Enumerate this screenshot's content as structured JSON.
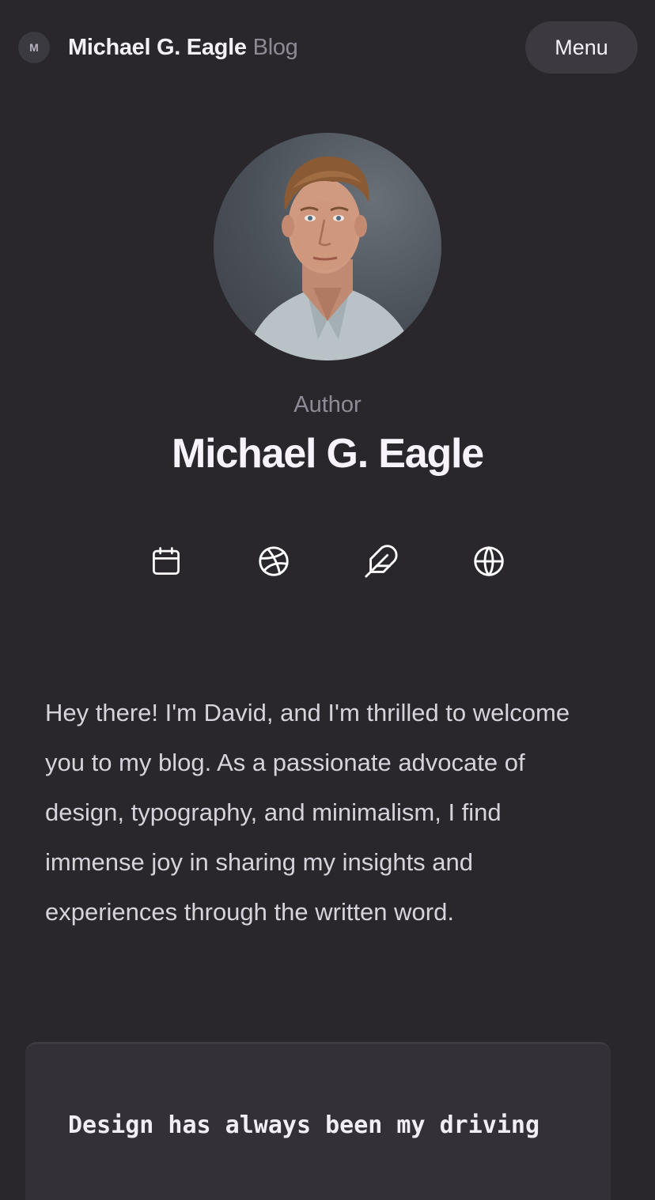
{
  "header": {
    "logo_initial": "M",
    "site_name": "Michael G. Eagle",
    "site_suffix": "Blog",
    "menu_label": "Menu"
  },
  "profile": {
    "label": "Author",
    "name": "Michael G. Eagle",
    "photo_alt": "Michael G. Eagle"
  },
  "social_icons": [
    {
      "icon": "calendar-icon"
    },
    {
      "icon": "dribbble-icon"
    },
    {
      "icon": "feather-icon"
    },
    {
      "icon": "globe-icon"
    }
  ],
  "bio": {
    "text": "Hey there! I'm David, and I'm thrilled to welcome you to my blog. As a passionate advocate of design, typography, and minimalism, I find immense joy in sharing my insights and experiences through the written word."
  },
  "code_block": {
    "text": "Design has always been my driving"
  },
  "colors": {
    "background": "#29272c",
    "card": "#333137",
    "text_primary": "#f7f2fb",
    "text_muted": "#8f8b96"
  }
}
